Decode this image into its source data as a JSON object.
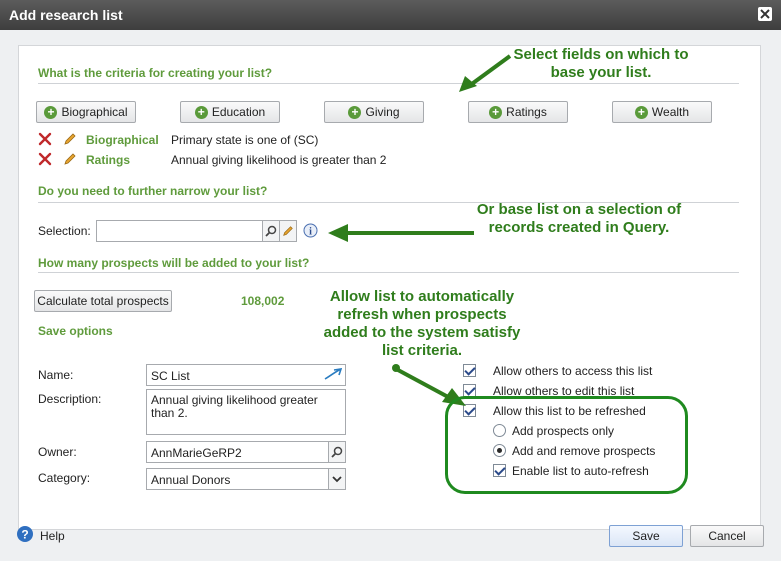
{
  "window": {
    "title": "Add research list"
  },
  "sections": {
    "criteria": "What is the criteria for creating your list?",
    "narrow": "Do you need to further narrow your list?",
    "prospects": "How many prospects will be added to your list?",
    "save": "Save options"
  },
  "criteria_buttons": [
    "Biographical",
    "Education",
    "Giving",
    "Ratings",
    "Wealth"
  ],
  "criteria_rows": [
    {
      "field": "Biographical",
      "text": "Primary state is one of (SC)"
    },
    {
      "field": "Ratings",
      "text": "Annual giving likelihood is greater than 2"
    }
  ],
  "selection": {
    "label": "Selection:",
    "value": ""
  },
  "prospects": {
    "button": "Calculate total prospects",
    "total": "108,002"
  },
  "form": {
    "name_label": "Name:",
    "name_value": "SC List",
    "description_label": "Description:",
    "description_value": "Annual giving likelihood greater than 2.",
    "owner_label": "Owner:",
    "owner_value": "AnnMarieGeRP2",
    "category_label": "Category:",
    "category_value": "Annual Donors"
  },
  "options": {
    "allow_access": "Allow others to access this list",
    "allow_edit": "Allow others to edit this list",
    "allow_refresh": "Allow this list to be refreshed",
    "add_only": "Add prospects only",
    "add_remove": "Add and remove prospects",
    "auto_refresh": "Enable list to auto-refresh"
  },
  "annotations": {
    "fields": "Select fields on which to base your list.",
    "query": "Or base list on a selection of records created in Query.",
    "refresh": "Allow list to automatically refresh when prospects added to the system satisfy list criteria."
  },
  "footer": {
    "help": "Help",
    "save": "Save",
    "cancel": "Cancel"
  },
  "colors": {
    "accent_green": "#5f9b3c",
    "annotation_green": "#2f7d1c",
    "highlight_circle": "#1f8a1f"
  }
}
